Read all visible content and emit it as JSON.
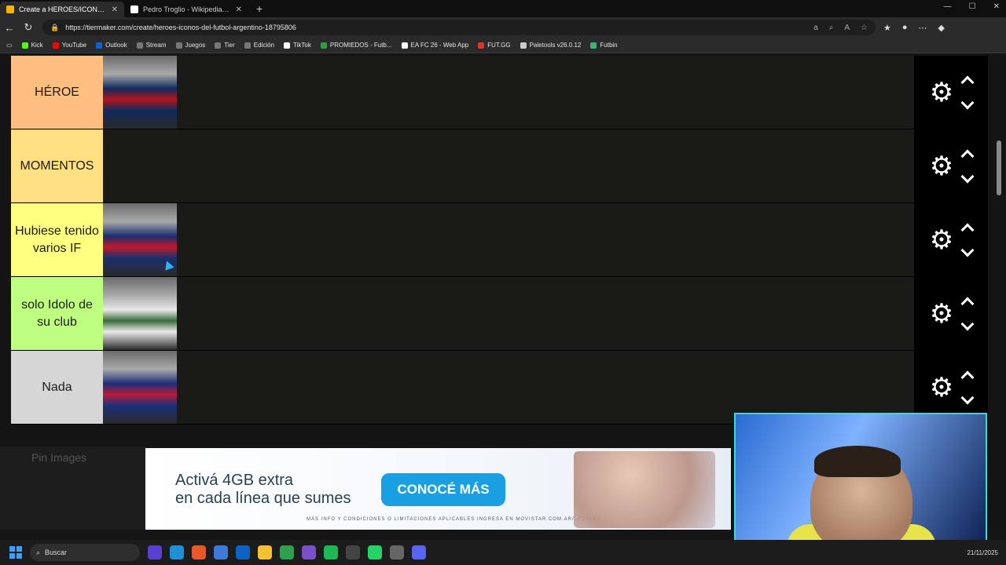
{
  "browser": {
    "tabs": [
      {
        "title": "Create a HEROES/ICONOS del FU",
        "color": "#ffb500",
        "active": true
      },
      {
        "title": "Pedro Troglio - Wikipedia, la enci",
        "color": "#ffffff",
        "active": false
      }
    ],
    "new_tab": "+",
    "url": "https://tiermaker.com/create/heroes-iconos-del-futbol-argentino-18795806",
    "bookmarks": [
      {
        "label": "Kick",
        "color": "#53fc18"
      },
      {
        "label": "YouTube",
        "color": "#ff0000"
      },
      {
        "label": "Outlook",
        "color": "#0a64d6"
      },
      {
        "label": "Stream",
        "color": "#777777"
      },
      {
        "label": "Juegos",
        "color": "#777777"
      },
      {
        "label": "Tier",
        "color": "#777777"
      },
      {
        "label": "Edición",
        "color": "#777777"
      },
      {
        "label": "TikTok",
        "color": "#ffffff"
      },
      {
        "label": "PROMIEDOS - Futb...",
        "color": "#2ea043"
      },
      {
        "label": "EA FC 26 - Web App",
        "color": "#ffffff"
      },
      {
        "label": "FUT.GG",
        "color": "#e0332b"
      },
      {
        "label": "Paletools v26.0.12",
        "color": "#cccccc"
      },
      {
        "label": "Futbin",
        "color": "#3cb371"
      }
    ]
  },
  "tiers": [
    {
      "label": "HÉROE",
      "color": "#ffbf7f",
      "players": [
        "player-heroe-1"
      ]
    },
    {
      "label": "MOMENTOS",
      "color": "#ffdf7f",
      "players": []
    },
    {
      "label": "Hubiese tenido varios IF",
      "color": "#ffff7f",
      "players": [
        "player-if-1"
      ]
    },
    {
      "label": "solo Idolo de su club",
      "color": "#bfff7f",
      "players": [
        "player-club-1"
      ]
    },
    {
      "label": "Nada",
      "color": "#d6d6d6",
      "players": [
        "player-nada-1"
      ]
    }
  ],
  "pin_images_label": "Pin Images",
  "ad": {
    "line1": "Activá 4GB extra",
    "line2": "en cada línea que sumes",
    "cta": "CONOCÉ MÁS",
    "fine_print": "MÁS INFO Y CONDICIONES O LIMITACIONES APLICABLES INGRESA EN MOVISTAR.COM.AR/LEGALES"
  },
  "taskbar": {
    "search_label": "Buscar",
    "date": "21/11/2025"
  }
}
